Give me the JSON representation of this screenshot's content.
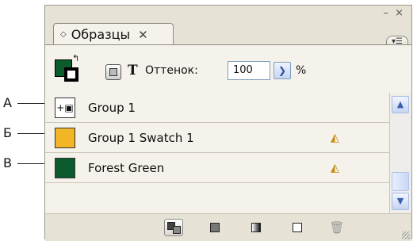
{
  "callouts": [
    "А",
    "Б",
    "В"
  ],
  "panel": {
    "tab_label": "Образцы",
    "window_controls": "– ×",
    "tint_label": "Оттенок:",
    "tint_value": "100",
    "tint_unit": "%",
    "text_toggle": "T"
  },
  "swatches": [
    {
      "label": "Group 1",
      "type": "group"
    },
    {
      "label": "Group 1 Swatch 1",
      "color": "#f2b526",
      "cmyk_icon": "color-mode-icon"
    },
    {
      "label": "Forest Green",
      "color": "#0b5b2f",
      "cmyk_icon": "color-mode-icon"
    }
  ],
  "colors": {
    "fill": "#0b5b2f",
    "panel_bg": "#f4f2ea",
    "accent": "#3b5fb0"
  },
  "icons": {
    "tab_diamond": "diamond-icon",
    "tab_close": "close-icon",
    "panel_menu": "panel-menu-icon",
    "bottom": [
      "show-all-swatches-icon",
      "show-color-swatches-icon",
      "show-gradient-swatches-icon",
      "new-swatch-icon",
      "trash-icon"
    ]
  }
}
